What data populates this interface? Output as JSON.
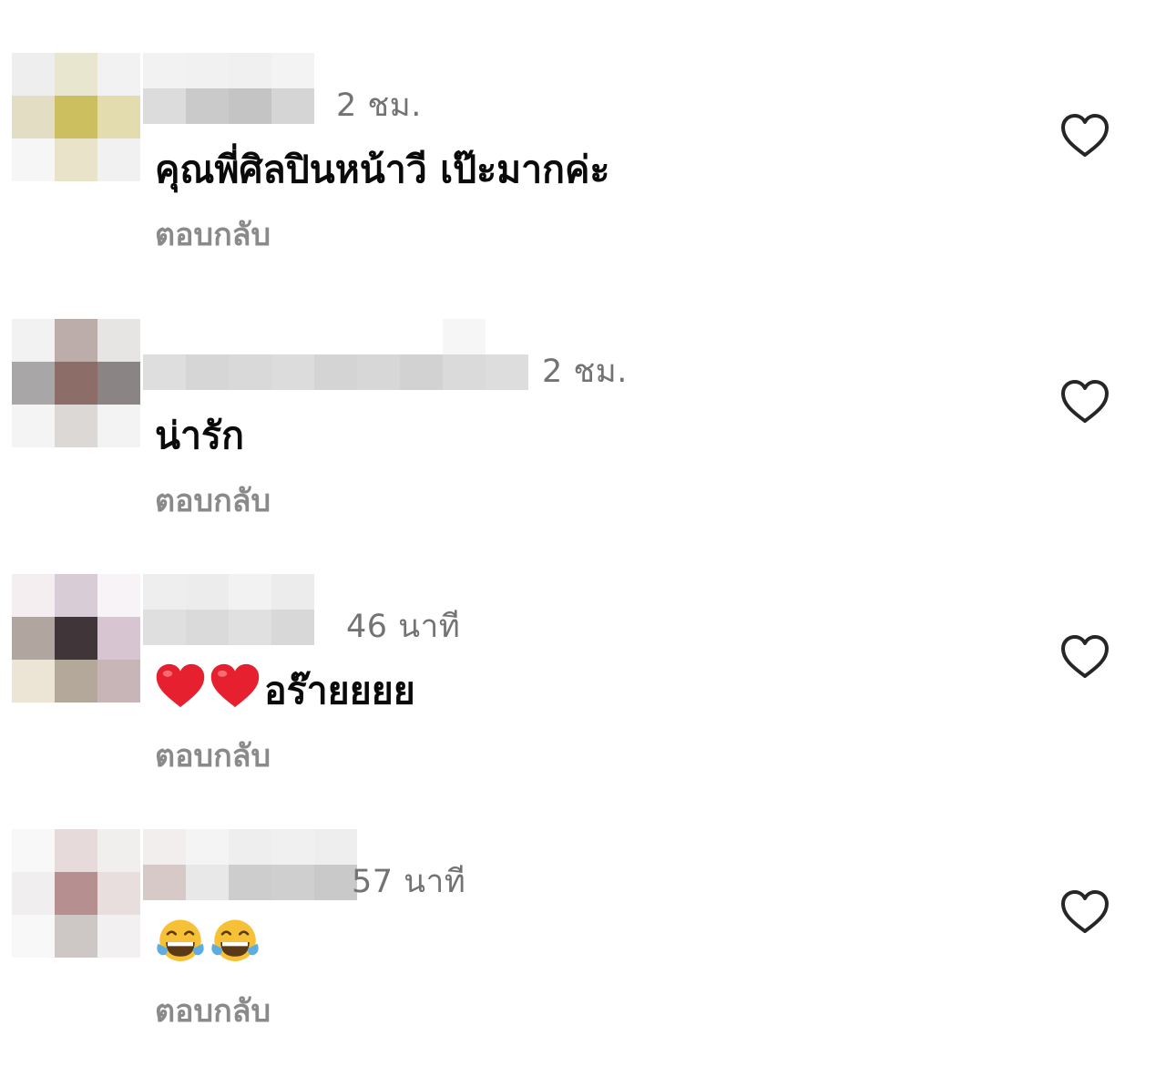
{
  "comments": [
    {
      "time": "2 ชม.",
      "text": "คุณพี่ศิลปินหน้าวี เป๊ะมากค่ะ",
      "emojis": [],
      "reply_label": "ตอบกลับ",
      "avatar_colors": [
        "#eeeeee",
        "#e9e6cf",
        "#f2f2f2",
        "#e3ddc4",
        "#cbbf60",
        "#e2dcae",
        "#f6f6f6",
        "#e8e3c9",
        "#f1f1f1"
      ],
      "username_colors": [
        [
          "#f2f2f2",
          "#dcdcdc"
        ],
        [
          "#f1f1f1",
          "#cacaca"
        ],
        [
          "#f0f0f0",
          "#c4c4c4"
        ],
        [
          "#f3f3f3",
          "#d5d5d5"
        ]
      ]
    },
    {
      "time": "2 ชม.",
      "text": "น่ารัก",
      "emojis": [],
      "reply_label": "ตอบกลับ",
      "avatar_colors": [
        "#f2f2f2",
        "#bcadab",
        "#e6e5e4",
        "#a8a6a7",
        "#8c6d67",
        "#8a8584",
        "#f4f4f4",
        "#dcd8d6",
        "#f3f3f3"
      ],
      "username_colors": [
        [
          "#ffffff",
          "#dedede"
        ],
        [
          "#ffffff",
          "#d6d6d6"
        ],
        [
          "#ffffff",
          "#d9d9d9"
        ],
        [
          "#ffffff",
          "#dcdcdc"
        ],
        [
          "#ffffff",
          "#d4d4d4"
        ],
        [
          "#ffffff",
          "#d7d7d7"
        ],
        [
          "#ffffff",
          "#d2d2d2"
        ],
        [
          "#f6f6f6",
          "#dadada"
        ],
        [
          "#ffffff",
          "#dddddd"
        ]
      ]
    },
    {
      "time": "46 นาที",
      "text": "อร๊ายยยย",
      "emojis": [
        "red-heart",
        "red-heart"
      ],
      "reply_label": "ตอบกลับ",
      "avatar_colors": [
        "#f5eef0",
        "#d8ccd6",
        "#f8f3f6",
        "#b0a59f",
        "#403538",
        "#d7c6d1",
        "#ece4d5",
        "#b3a89a",
        "#c8b5b8"
      ],
      "username_colors": [
        [
          "#eeeeee",
          "#dfdfdf"
        ],
        [
          "#ececec",
          "#dadada"
        ],
        [
          "#f2f2f2",
          "#e0e0e0"
        ],
        [
          "#ececec",
          "#d8d8d8"
        ]
      ]
    },
    {
      "time": "57 นาที",
      "text": "",
      "emojis": [
        "tears-of-joy",
        "tears-of-joy"
      ],
      "reply_label": "ตอบกลับ",
      "avatar_colors": [
        "#f8f8f8",
        "#e6dada",
        "#f1eeee",
        "#f0eeee",
        "#b69090",
        "#e8dede",
        "#f8f8f8",
        "#cdc8c6",
        "#f2f0f0"
      ],
      "username_colors": [
        [
          "#f2eeee",
          "#d8c9c9"
        ],
        [
          "#f4f4f4",
          "#e8e8e8"
        ],
        [
          "#eeeeee",
          "#cdcdcd"
        ],
        [
          "#f0f0f0",
          "#cfcfcf"
        ],
        [
          "#eeeeee",
          "#c9c9c9"
        ]
      ]
    }
  ],
  "colors": {
    "text": "#0a0a0a",
    "meta": "#737373",
    "reply": "#8a8a8a",
    "heart_outline": "#262626",
    "emoji_red": "#e6202e",
    "emoji_yellow": "#f7c137",
    "emoji_tear": "#5dade2"
  },
  "icons": {
    "like": "heart-outline-icon",
    "red_heart": "red-heart-emoji",
    "tears_of_joy": "tears-of-joy-emoji"
  }
}
